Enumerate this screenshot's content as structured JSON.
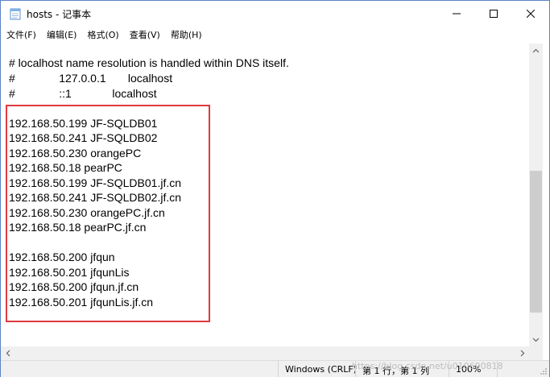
{
  "window": {
    "title": "hosts - 记事本",
    "icon": "notepad-icon",
    "controls": [
      "minimize-icon",
      "maximize-icon",
      "close-icon"
    ]
  },
  "menu": {
    "items": [
      {
        "label": "文件(F)"
      },
      {
        "label": "编辑(E)"
      },
      {
        "label": "格式(O)"
      },
      {
        "label": "查看(V)"
      },
      {
        "label": "帮助(H)"
      }
    ]
  },
  "editor": {
    "lines": [
      "# localhost name resolution is handled within DNS itself.",
      "#              127.0.0.1       localhost",
      "#              ::1             localhost",
      "",
      "192.168.50.199 JF-SQLDB01",
      "192.168.50.241 JF-SQLDB02",
      "192.168.50.230 orangePC",
      "192.168.50.18 pearPC",
      "192.168.50.199 JF-SQLDB01.jf.cn",
      "192.168.50.241 JF-SQLDB02.jf.cn",
      "192.168.50.230 orangePC.jf.cn",
      "192.168.50.18 pearPC.jf.cn",
      "",
      "192.168.50.200 jfqun",
      "192.168.50.201 jfqunLis",
      "192.168.50.200 jfqun.jf.cn",
      "192.168.50.201 jfqunLis.jf.cn"
    ],
    "highlight_color": "#e0393e"
  },
  "statusbar": {
    "encoding": "Windows (CRLF)",
    "position": "第 1 行，第 1 列",
    "zoom": "100%",
    "watermark": "https://blog.csdn.net/u010690818"
  },
  "colors": {
    "window_border": "#5a84c4",
    "chrome": "#f0f0f0",
    "scroll_thumb": "#cdcdcd"
  }
}
